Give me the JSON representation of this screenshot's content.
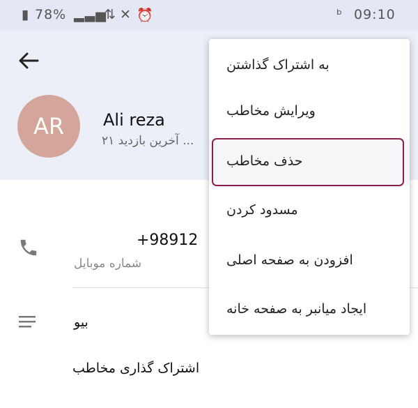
{
  "status_bar": {
    "battery": "78%",
    "time": "09:10"
  },
  "contact": {
    "avatar_initials": "AR",
    "avatar_color": "#d4a59a",
    "name": "Ali reza",
    "last_seen": "آخرین بازدید ۲۱ ..."
  },
  "info": {
    "phone": "+98912",
    "phone_label": "شماره موبایل",
    "bio_label": "بیو",
    "share_label": "اشتراک گذاری مخاطب"
  },
  "menu": {
    "items": [
      "به اشتراک گذاشتن",
      "ویرایش مخاطب",
      "حذف مخاطب",
      "مسدود کردن",
      "افزودن به صفحه اصلی",
      "ایجاد میانبر به صفحه خانه"
    ],
    "selected_index": 2
  },
  "colors": {
    "accent": "#8b1e4c",
    "header_bg": "#eceef8"
  }
}
